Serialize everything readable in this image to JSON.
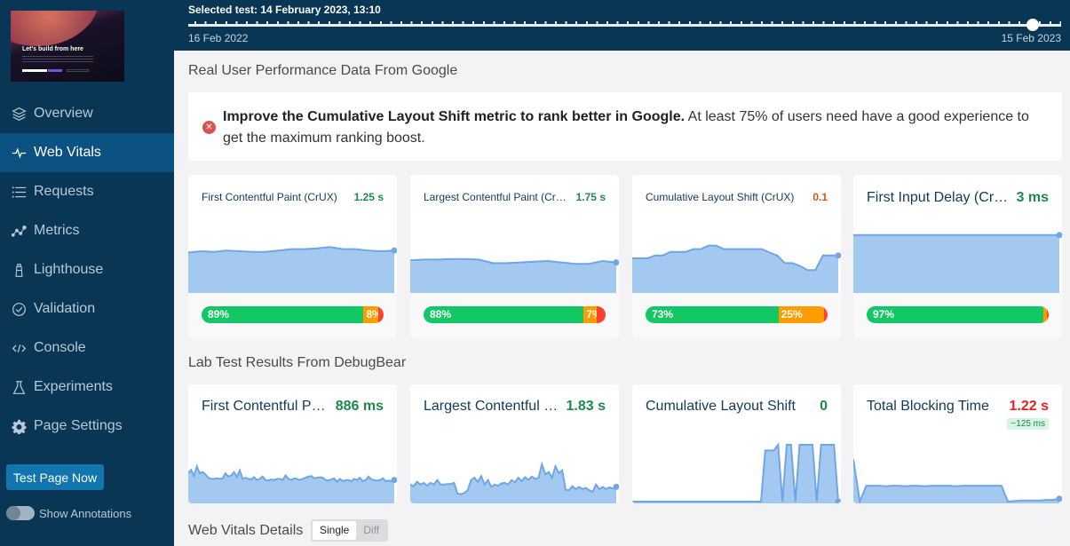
{
  "sidebar": {
    "thumbnail_headline": "Let's build from here",
    "items": [
      {
        "label": "Overview",
        "icon": "layers-icon",
        "active": false
      },
      {
        "label": "Web Vitals",
        "icon": "pulse-icon",
        "active": true
      },
      {
        "label": "Requests",
        "icon": "list-icon",
        "active": false
      },
      {
        "label": "Metrics",
        "icon": "line-chart-icon",
        "active": false
      },
      {
        "label": "Lighthouse",
        "icon": "lighthouse-icon",
        "active": false
      },
      {
        "label": "Validation",
        "icon": "check-circle-icon",
        "active": false
      },
      {
        "label": "Console",
        "icon": "code-icon",
        "active": false
      },
      {
        "label": "Experiments",
        "icon": "flask-icon",
        "active": false
      },
      {
        "label": "Page Settings",
        "icon": "gear-icon",
        "active": false
      }
    ],
    "test_button": "Test Page Now",
    "annotations_toggle": {
      "label": "Show Annotations",
      "on": false
    }
  },
  "timeline": {
    "selected_label": "Selected test: 14 February 2023, 13:10",
    "start_date": "16 Feb 2022",
    "end_date": "15 Feb 2023",
    "selected_position": 0.967
  },
  "crux": {
    "title": "Real User Performance Data From Google",
    "alert": {
      "bold": "Improve the Cumulative Layout Shift metric to rank better in Google.",
      "text": " At least 75% of users need have a good experience to get the maximum ranking boost."
    },
    "cards": [
      {
        "title": "First Contentful Paint (CrUX)",
        "value": "1.25 s",
        "status": "good",
        "distribution": {
          "good": 89,
          "ni": 8,
          "poor": 3
        },
        "good_label": "89%",
        "ni_label": "8%",
        "series": [
          0.55,
          0.57,
          0.56,
          0.58,
          0.57,
          0.56,
          0.56,
          0.58,
          0.6,
          0.6,
          0.61,
          0.63,
          0.6,
          0.6,
          0.58,
          0.57,
          0.58
        ]
      },
      {
        "title": "Largest Contentful Paint (CrUX)",
        "value": "1.75 s",
        "status": "good",
        "distribution": {
          "good": 88,
          "ni": 7,
          "poor": 5
        },
        "good_label": "88%",
        "ni_label": "7%",
        "series": [
          0.44,
          0.45,
          0.45,
          0.46,
          0.46,
          0.45,
          0.4,
          0.4,
          0.41,
          0.42,
          0.43,
          0.41,
          0.39,
          0.39,
          0.43,
          0.41
        ]
      },
      {
        "title": "Cumulative Layout Shift (CrUX)",
        "value": "0.1",
        "status": "ni",
        "distribution": {
          "good": 73,
          "ni": 25,
          "poor": 2
        },
        "good_label": "73%",
        "ni_label": "25%",
        "series": [
          0.47,
          0.47,
          0.47,
          0.51,
          0.51,
          0.56,
          0.56,
          0.56,
          0.6,
          0.6,
          0.65,
          0.65,
          0.6,
          0.6,
          0.6,
          0.6,
          0.6,
          0.6,
          0.55,
          0.51,
          0.4,
          0.4,
          0.36,
          0.3,
          0.3,
          0.51,
          0.51,
          0.51
        ]
      },
      {
        "title": "First Input Delay (CrUX)",
        "value": "3 ms",
        "status": "good",
        "distribution": {
          "good": 97,
          "ni": 2,
          "poor": 1
        },
        "good_label": "97%",
        "ni_label": "",
        "series": [
          0.8,
          0.8
        ]
      }
    ]
  },
  "lab": {
    "title": "Lab Test Results From DebugBear",
    "cards": [
      {
        "title": "First Contentful Paint",
        "value": "886 ms",
        "status": "good",
        "delta": "",
        "series": [
          0.5,
          0.56,
          0.45,
          0.62,
          0.5,
          0.52,
          0.48,
          0.42,
          0.4,
          0.4,
          0.41,
          0.4,
          0.41,
          0.5,
          0.44,
          0.46,
          0.52,
          0.43,
          0.55,
          0.4,
          0.42,
          0.4,
          0.39,
          0.43,
          0.38,
          0.4,
          0.44,
          0.38,
          0.37,
          0.39,
          0.38,
          0.4,
          0.4,
          0.38,
          0.46,
          0.4,
          0.38,
          0.41,
          0.4,
          0.38,
          0.4,
          0.42,
          0.44,
          0.45,
          0.41,
          0.42,
          0.43,
          0.42,
          0.38,
          0.37,
          0.39,
          0.41,
          0.35,
          0.4,
          0.36,
          0.38,
          0.38,
          0.36,
          0.4,
          0.38,
          0.42,
          0.36,
          0.38,
          0.44,
          0.39,
          0.38,
          0.37,
          0.38,
          0.41,
          0.36,
          0.37,
          0.36,
          0.38
        ]
      },
      {
        "title": "Largest Contentful Paint",
        "value": "1.83 s",
        "status": "good",
        "delta": "",
        "series": [
          0.3,
          0.27,
          0.35,
          0.3,
          0.33,
          0.28,
          0.33,
          0.3,
          0.38,
          0.3,
          0.3,
          0.31,
          0.31,
          0.33,
          0.14,
          0.13,
          0.15,
          0.2,
          0.38,
          0.42,
          0.35,
          0.45,
          0.3,
          0.38,
          0.26,
          0.3,
          0.28,
          0.32,
          0.33,
          0.3,
          0.38,
          0.34,
          0.42,
          0.36,
          0.43,
          0.38,
          0.44,
          0.4,
          0.42,
          0.66,
          0.48,
          0.52,
          0.42,
          0.62,
          0.5,
          0.55,
          0.21,
          0.2,
          0.27,
          0.22,
          0.26,
          0.22,
          0.24,
          0.2,
          0.17,
          0.3,
          0.22,
          0.26,
          0.22,
          0.25,
          0.23,
          0.26
        ]
      },
      {
        "title": "Cumulative Layout Shift",
        "value": "0",
        "status": "good",
        "delta": "",
        "series": [
          0,
          0,
          0,
          0,
          0,
          0,
          0,
          0,
          0,
          0,
          0,
          0,
          0,
          0,
          0,
          0,
          0,
          0,
          0,
          0,
          0,
          0,
          0,
          0,
          0,
          0,
          0,
          0,
          0,
          0,
          0,
          0.9,
          0.9,
          0.9,
          1,
          0,
          1,
          1,
          0,
          1,
          1,
          1,
          1,
          0,
          1,
          1,
          1,
          1,
          0
        ]
      },
      {
        "title": "Total Blocking Time",
        "value": "1.22 s",
        "status": "poor",
        "delta": "−125 ms",
        "series": [
          0.75,
          0,
          0.28,
          0.28,
          0.28,
          0.27,
          0.28,
          0.28,
          0.27,
          0.28,
          0.28,
          0.27,
          0.28,
          0.28,
          0.28,
          0.28,
          0.27,
          0.28,
          0.28,
          0.28,
          0.28,
          0.28,
          0.28,
          0.28,
          0,
          0.01,
          0.02,
          0.02,
          0.02,
          0.02,
          0.03,
          0.03,
          0.05
        ]
      }
    ]
  },
  "details": {
    "title": "Web Vitals Details",
    "modes": [
      "Single",
      "Diff"
    ],
    "selected_mode": "Single"
  },
  "colors": {
    "good": "#1d8a4a",
    "ni": "#d4560f",
    "poor": "#e02424",
    "chart_fill": "#a4c9f0",
    "chart_line": "#6ea6e6"
  }
}
